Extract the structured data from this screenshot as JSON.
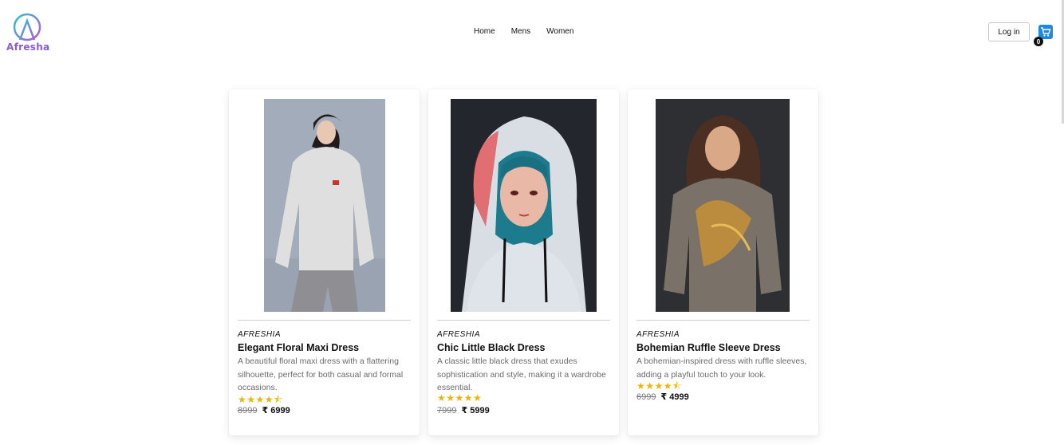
{
  "header": {
    "logo_text": "Afresha",
    "nav": [
      "Home",
      "Mens",
      "Women"
    ],
    "login_label": "Log in",
    "cart_count": "0"
  },
  "colors": {
    "accent": "#1e88e5",
    "star": "#f5b301"
  },
  "products": [
    {
      "brand": "AFRESHIA",
      "title": "Elegant Floral Maxi Dress",
      "description": "A beautiful floral maxi dress with a flattering silhouette, perfect for both casual and formal occasions.",
      "rating": 4.5,
      "stars": "★★★★⯪",
      "old_price": "8999",
      "currency": "₹",
      "new_price": "6999"
    },
    {
      "brand": "AFRESHIA",
      "title": "Chic Little Black Dress",
      "description": "A classic little black dress that exudes sophistication and style, making it a wardrobe essential.",
      "rating": 5,
      "stars": "★★★★★",
      "old_price": "7999",
      "currency": "₹",
      "new_price": "5999"
    },
    {
      "brand": "AFRESHIA",
      "title": "Bohemian Ruffle Sleeve Dress",
      "description": "A bohemian-inspired dress with ruffle sleeves, adding a playful touch to your look.",
      "rating": 4.5,
      "stars": "★★★★⯪",
      "old_price": "6999",
      "currency": "₹",
      "new_price": "4999"
    }
  ]
}
